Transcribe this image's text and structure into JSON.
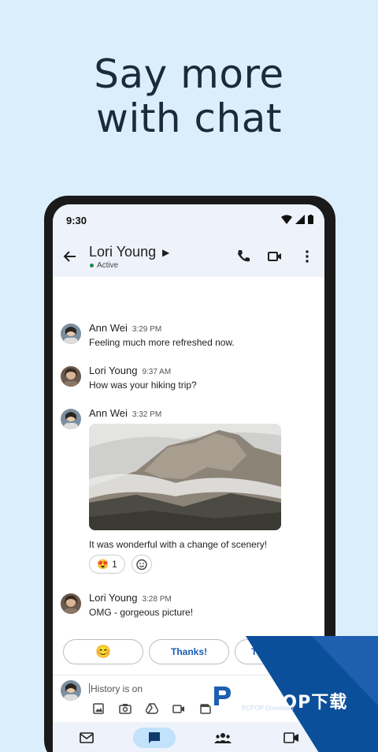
{
  "headline": {
    "line1": "Say more",
    "line2": "with chat"
  },
  "status_bar": {
    "time": "9:30"
  },
  "app_bar": {
    "contact_name": "Lori Young",
    "status": "Active"
  },
  "messages": [
    {
      "sender": "Ann Wei",
      "time": "3:29 PM",
      "text": "Feeling much more refreshed now."
    },
    {
      "sender": "Lori Young",
      "time": "9:37 AM",
      "text": "How was your hiking trip?"
    },
    {
      "sender": "Ann Wei",
      "time": "3:32 PM",
      "text": "It was wonderful with a change of scenery!",
      "reaction_emoji": "😍",
      "reaction_count": "1"
    },
    {
      "sender": "Lori Young",
      "time": "3:28 PM",
      "text": "OMG - gorgeous picture!"
    }
  ],
  "suggestions": [
    "😊",
    "Thanks!",
    "Th"
  ],
  "composer": {
    "placeholder": "History is on"
  },
  "icons": {
    "back": "arrow-left-icon",
    "call": "phone-icon",
    "video": "video-icon",
    "more": "more-vert-icon",
    "nav": [
      "mail-icon",
      "chat-icon",
      "people-icon",
      "video-icon"
    ]
  },
  "watermark": {
    "brand": "PCPOP下载",
    "sub": "PCPOP Download"
  },
  "colors": {
    "background": "#dbeefb",
    "accent": "#1a5bb3",
    "nav_selected": "#c2e1fb",
    "active_dot": "#1e8e3e"
  }
}
